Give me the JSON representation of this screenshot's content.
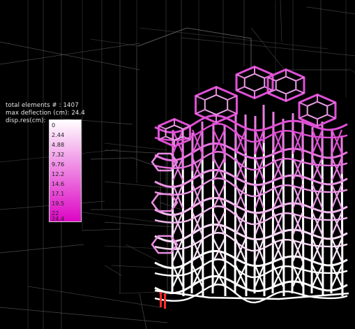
{
  "stats": {
    "total_elements": "total elements # : 1407",
    "max_deflection": "max deflection (cm): 24.4",
    "legend_title": "disp.res(cm):"
  },
  "legend": {
    "labels": [
      "0",
      "2.44",
      "4.88",
      "7.32",
      "9.76",
      "12.2",
      "14.6",
      "17.1",
      "19.5",
      "22",
      "24.4"
    ],
    "colors": [
      "#ffffff",
      "#fce5f9",
      "#f8cdf3",
      "#f5b4ee",
      "#f19ae8",
      "#ee82e2",
      "#ea68dc",
      "#e750d6",
      "#e336d0",
      "#e01ecb",
      "#dd05c5"
    ]
  },
  "colors": {
    "background": "#000000",
    "structure_white": "#ffffff",
    "structure_magenta": "#e04fd6",
    "context_lines": "#5a5a5a",
    "figures": "#ff2b2b"
  }
}
